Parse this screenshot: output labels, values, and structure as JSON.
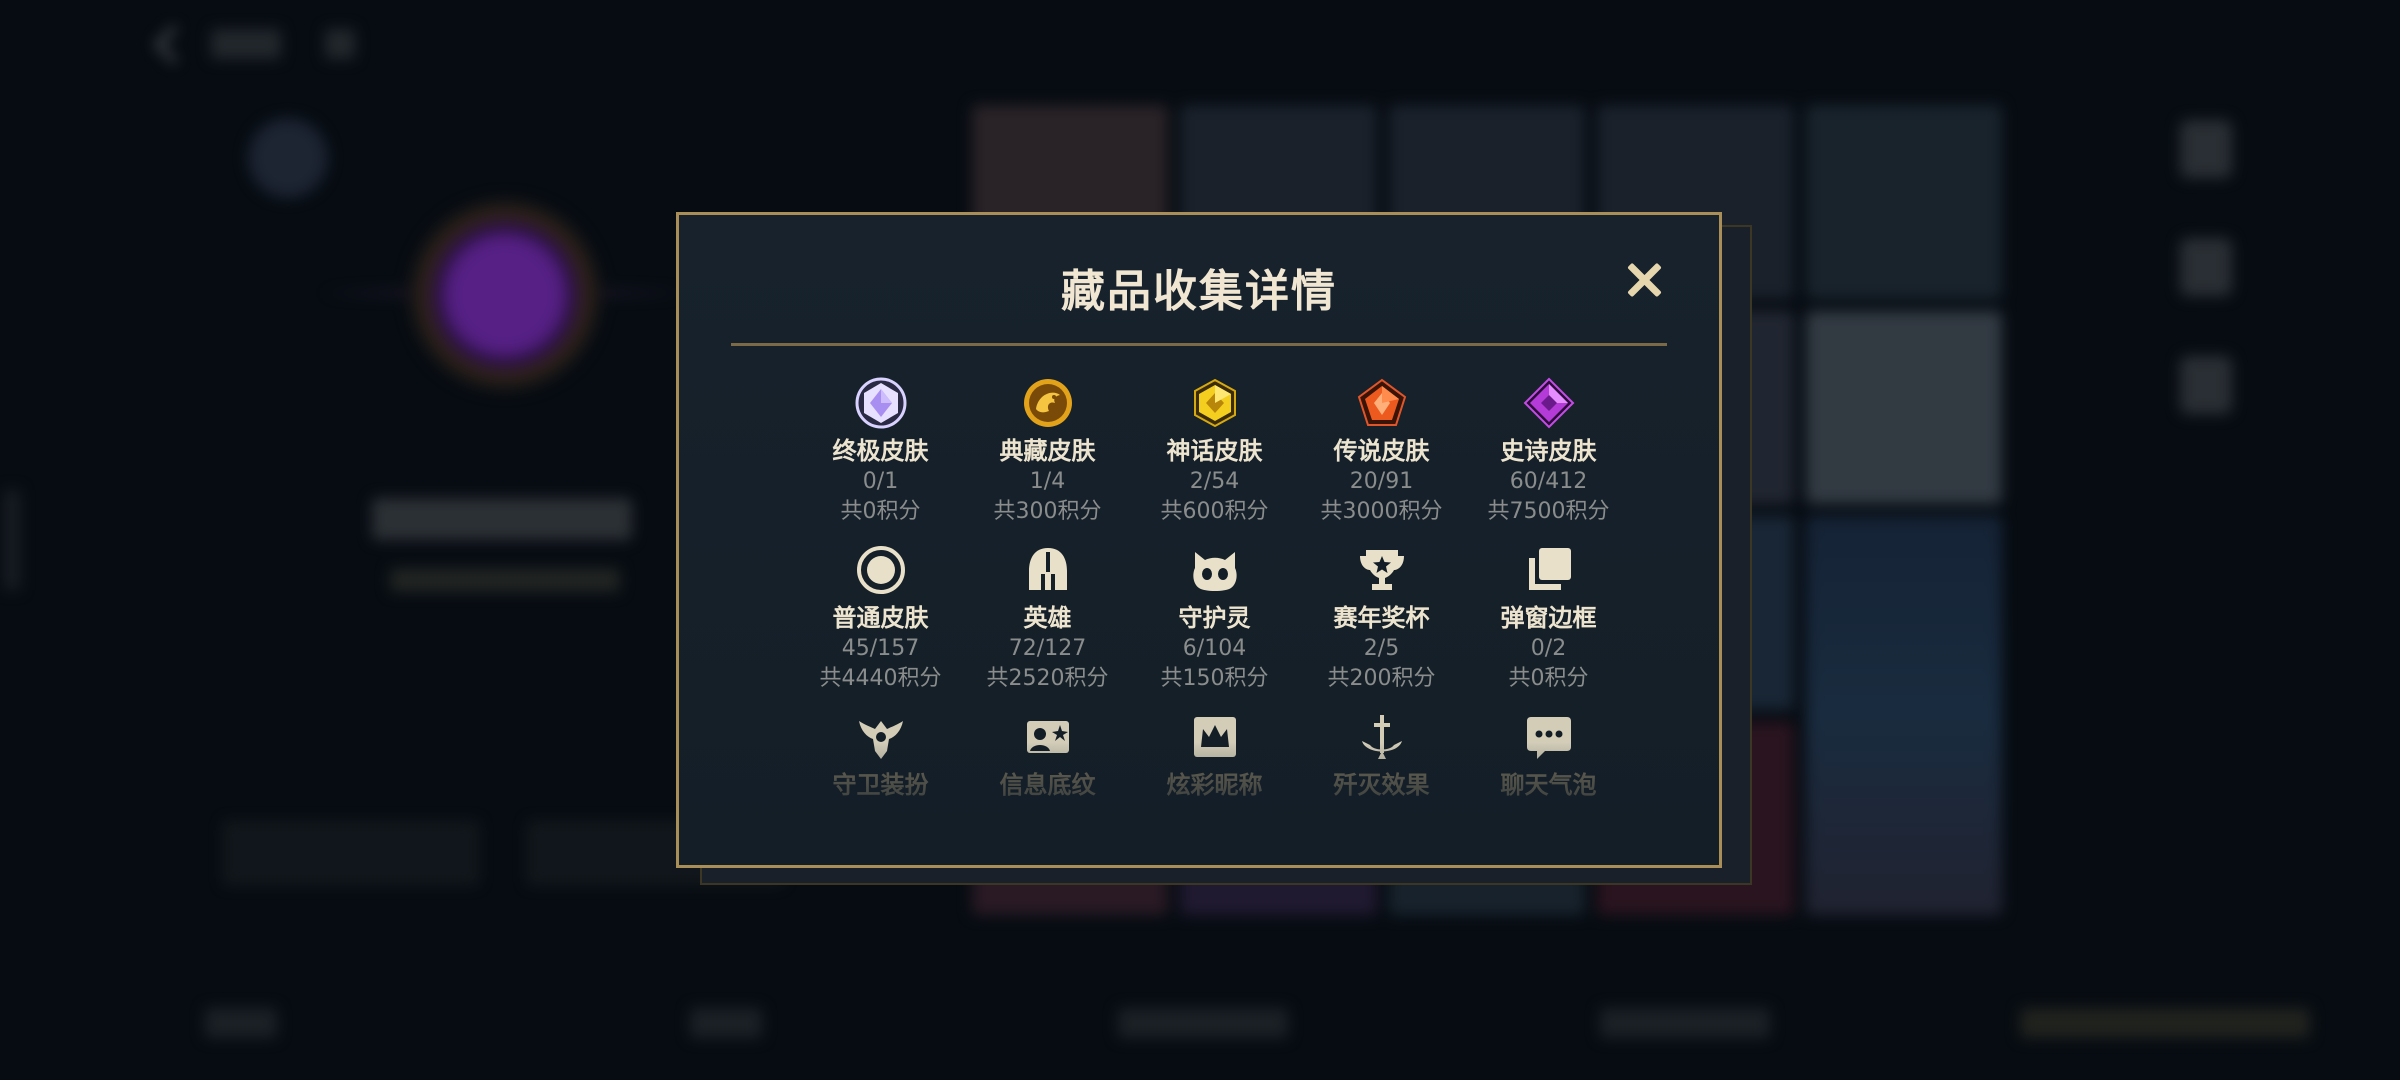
{
  "modal": {
    "title": "藏品收集详情",
    "rows": [
      [
        {
          "label": "终极皮肤",
          "count": "0/1",
          "points": "共0积分",
          "icon": "ultimate-skin-gem-icon"
        },
        {
          "label": "典藏皮肤",
          "count": "1/4",
          "points": "共300积分",
          "icon": "treasured-skin-dragon-icon"
        },
        {
          "label": "神话皮肤",
          "count": "2/54",
          "points": "共600积分",
          "icon": "mythic-skin-gem-icon"
        },
        {
          "label": "传说皮肤",
          "count": "20/91",
          "points": "共3000积分",
          "icon": "legendary-skin-gem-icon"
        },
        {
          "label": "史诗皮肤",
          "count": "60/412",
          "points": "共7500积分",
          "icon": "epic-skin-gem-icon"
        }
      ],
      [
        {
          "label": "普通皮肤",
          "count": "45/157",
          "points": "共4440积分",
          "icon": "normal-skin-ring-icon"
        },
        {
          "label": "英雄",
          "count": "72/127",
          "points": "共2520积分",
          "icon": "champion-helmet-icon"
        },
        {
          "label": "守护灵",
          "count": "6/104",
          "points": "共150积分",
          "icon": "guardian-spirit-icon"
        },
        {
          "label": "赛年奖杯",
          "count": "2/5",
          "points": "共200积分",
          "icon": "season-trophy-icon"
        },
        {
          "label": "弹窗边框",
          "count": "0/2",
          "points": "共0积分",
          "icon": "popup-frame-icon"
        }
      ],
      [
        {
          "label": "守卫装扮",
          "icon": "ward-skin-icon"
        },
        {
          "label": "信息底纹",
          "icon": "profile-banner-icon"
        },
        {
          "label": "炫彩昵称",
          "icon": "colorful-nickname-icon"
        },
        {
          "label": "歼灭效果",
          "icon": "kill-effect-icon"
        },
        {
          "label": "聊天气泡",
          "icon": "chat-bubble-icon"
        }
      ]
    ]
  },
  "colors": {
    "gold_border": "#a98e57",
    "title_text": "#f0e6d2",
    "muted_text": "#8a8d8c",
    "ultimate": "#c9b8ff",
    "treasured": "#e2a21a",
    "mythic": "#f5cf1f",
    "legendary": "#ec5a1f",
    "epic": "#b53bd9"
  }
}
